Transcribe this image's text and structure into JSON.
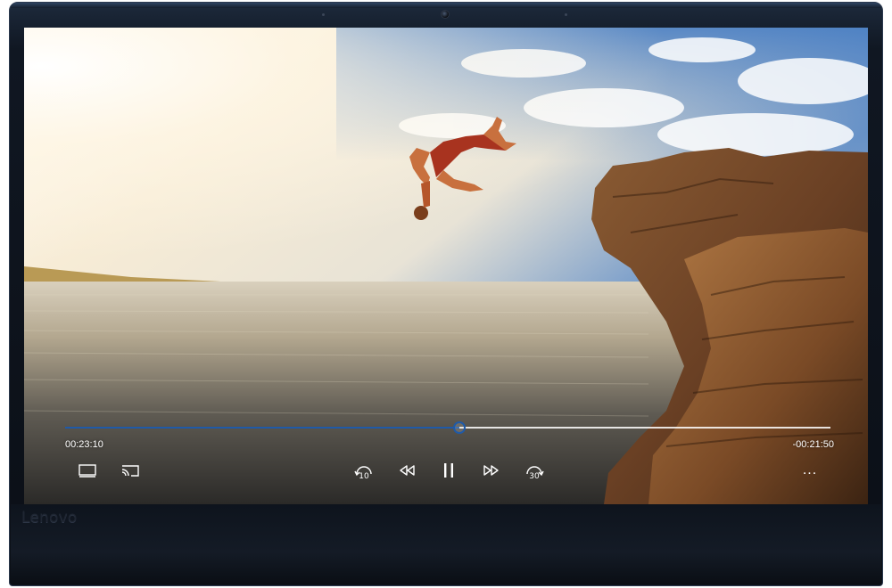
{
  "device": {
    "brand_logo": "Lenovo"
  },
  "player": {
    "elapsed_time": "00:23:10",
    "remaining_time": "-00:21:50",
    "progress_fraction": 0.515,
    "accent_color": "#1f5aa8",
    "controls": {
      "miniview": {
        "icon": "miniview-icon"
      },
      "cast": {
        "icon": "cast-to-device-icon"
      },
      "skip_back": {
        "icon": "skip-back-icon",
        "label": "10"
      },
      "rewind": {
        "icon": "rewind-icon"
      },
      "pause": {
        "icon": "pause-icon"
      },
      "fast_forward": {
        "icon": "fast-forward-icon"
      },
      "skip_forward": {
        "icon": "skip-forward-icon",
        "label": "30"
      },
      "more": {
        "icon": "more-options-icon",
        "label": "..."
      }
    }
  },
  "video_frame": {
    "description_icon": "cliff-diver-video-frame"
  }
}
